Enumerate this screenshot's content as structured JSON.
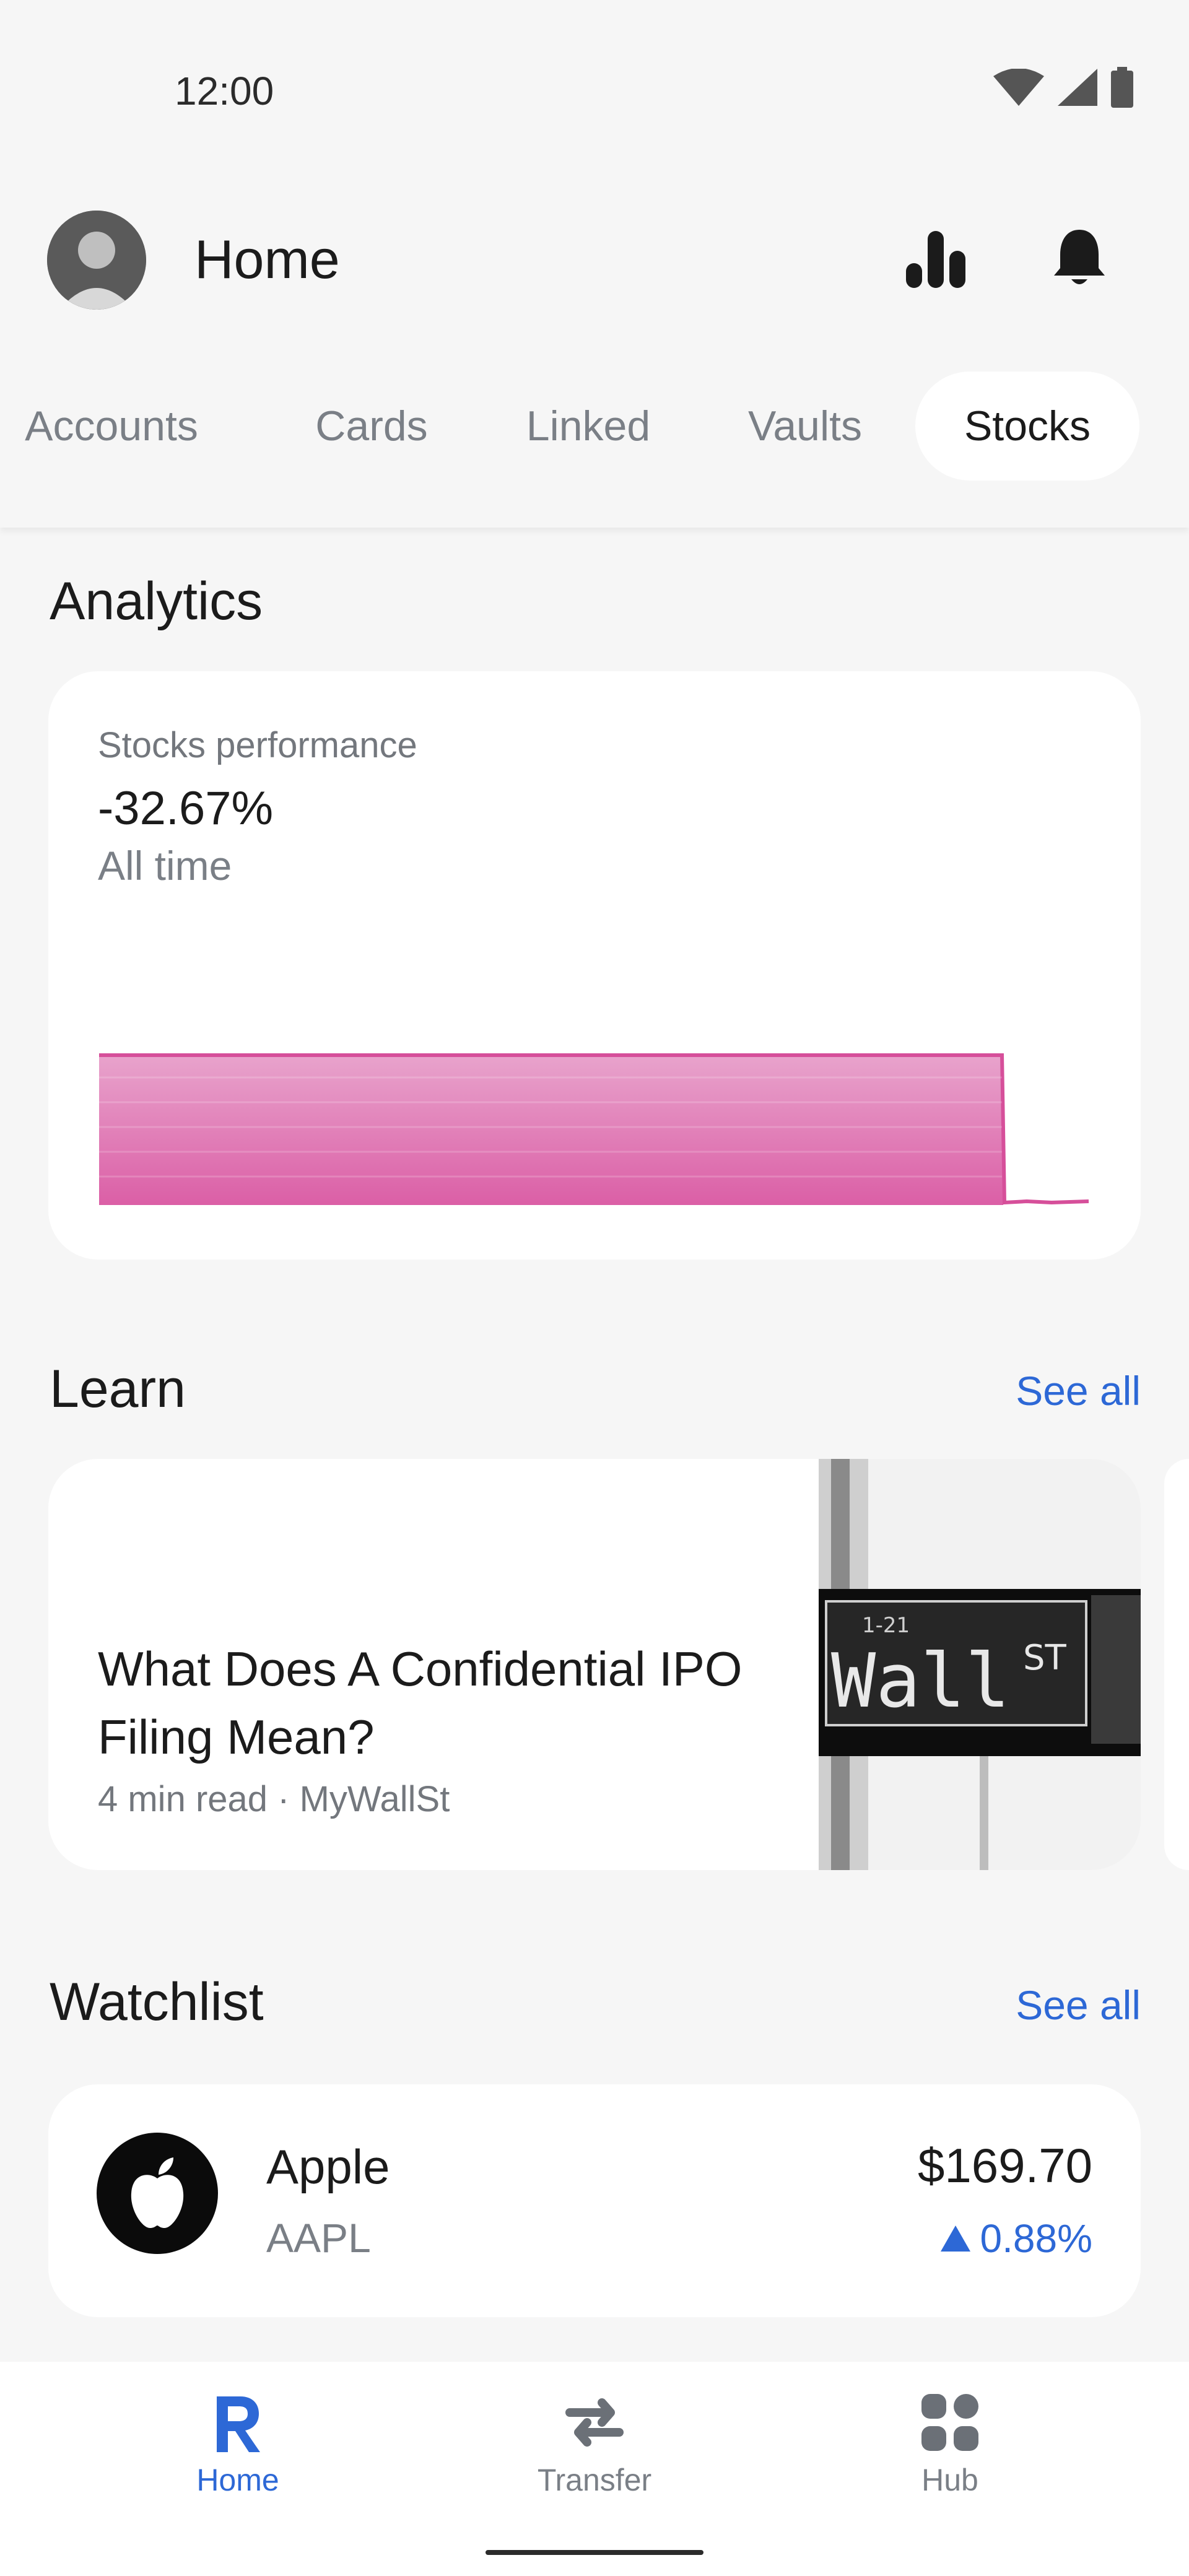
{
  "status_bar": {
    "time": "12:00"
  },
  "header": {
    "title": "Home"
  },
  "tabs": [
    {
      "label": "Accounts",
      "active": false
    },
    {
      "label": "Cards",
      "active": false
    },
    {
      "label": "Linked",
      "active": false
    },
    {
      "label": "Vaults",
      "active": false
    },
    {
      "label": "Stocks",
      "active": true
    }
  ],
  "analytics": {
    "title": "Analytics",
    "card": {
      "label": "Stocks performance",
      "value": "-32.67%",
      "period": "All time"
    }
  },
  "learn": {
    "title": "Learn",
    "see_all": "See all",
    "article": {
      "title": "What Does A Confidential IPO Filing Mean?",
      "meta": "4 min read · MyWallSt",
      "image_sign_text": "Wall",
      "image_sign_suffix": "ST",
      "image_sign_small": "1-21"
    }
  },
  "watchlist": {
    "title": "Watchlist",
    "see_all": "See all",
    "items": [
      {
        "name": "Apple",
        "ticker": "AAPL",
        "price": "$169.70",
        "change": "0.88%",
        "direction": "up"
      }
    ]
  },
  "bottom_nav": [
    {
      "label": "Home",
      "icon": "revolut-r-icon",
      "active": true
    },
    {
      "label": "Transfer",
      "icon": "transfer-arrows-icon",
      "active": false
    },
    {
      "label": "Hub",
      "icon": "grid-icon",
      "active": false
    }
  ],
  "colors": {
    "accent": "#2d68d6",
    "chart_fill": "#e07ab8",
    "chart_line": "#d64f9a",
    "background": "#f6f6f6"
  }
}
